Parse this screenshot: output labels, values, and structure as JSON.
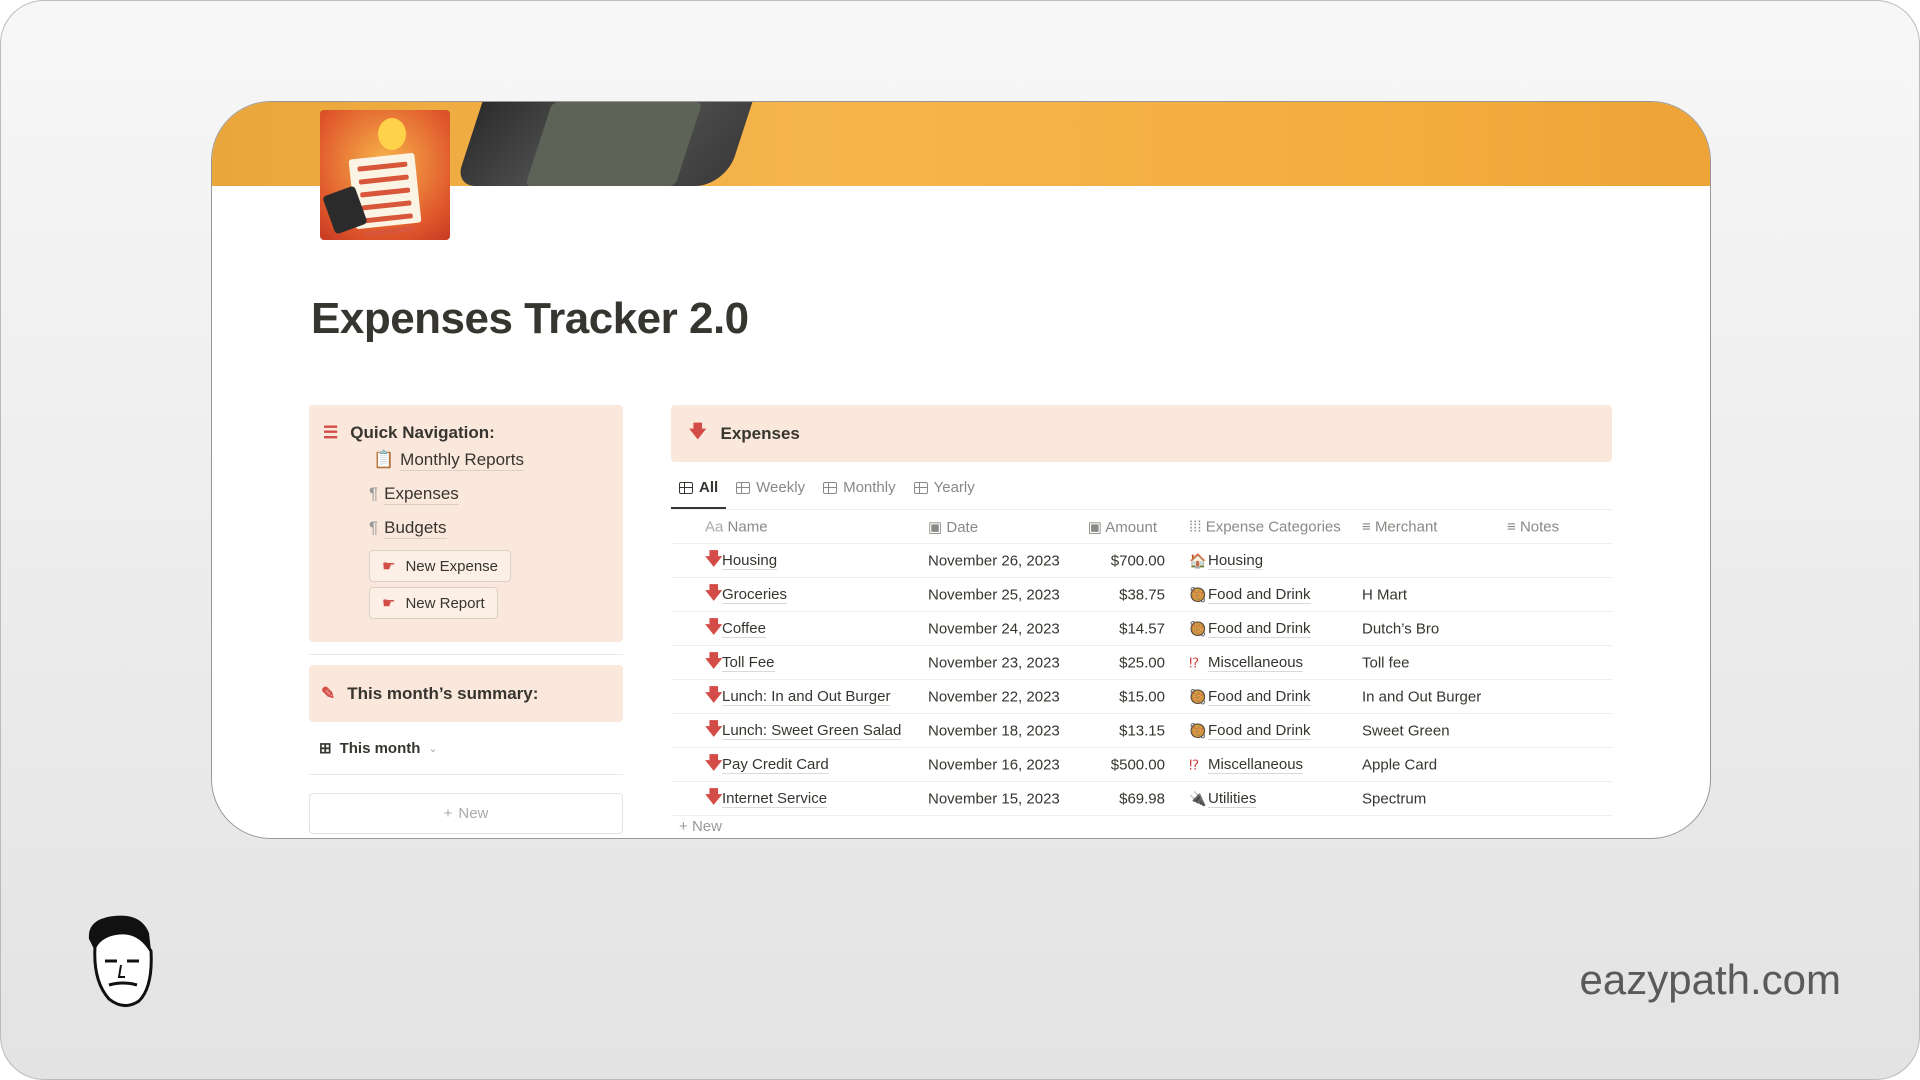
{
  "page": {
    "title": "Expenses Tracker 2.0"
  },
  "quick_nav": {
    "heading": "Quick Navigation:",
    "items": [
      {
        "label": "Monthly Reports",
        "icon": "report-icon"
      },
      {
        "label": "Expenses",
        "icon": "pilcrow-icon"
      },
      {
        "label": "Budgets",
        "icon": "pilcrow-icon"
      }
    ],
    "buttons": [
      {
        "label": "New Expense"
      },
      {
        "label": "New Report"
      }
    ]
  },
  "summary": {
    "heading": "This month’s summary:",
    "view_label": "This month",
    "new_label": "New"
  },
  "expenses": {
    "heading": "Expenses",
    "tabs": [
      {
        "label": "All",
        "active": true
      },
      {
        "label": "Weekly"
      },
      {
        "label": "Monthly"
      },
      {
        "label": "Yearly"
      }
    ],
    "columns": {
      "name": "Name",
      "name_prefix": "Aa",
      "date": "Date",
      "amount": "Amount",
      "category": "Expense Categories",
      "merchant": "Merchant",
      "notes": "Notes"
    },
    "rows": [
      {
        "name": "Housing",
        "date": "November 26, 2023",
        "amount": "$700.00",
        "category": "Housing",
        "cat_icon": "🏠",
        "merchant": ""
      },
      {
        "name": "Groceries",
        "date": "November 25, 2023",
        "amount": "$38.75",
        "category": "Food and Drink",
        "cat_icon": "🥘",
        "merchant": "H Mart"
      },
      {
        "name": "Coffee",
        "date": "November 24, 2023",
        "amount": "$14.57",
        "category": "Food and Drink",
        "cat_icon": "🥘",
        "merchant": "Dutch’s Bro"
      },
      {
        "name": "Toll Fee",
        "date": "November 23, 2023",
        "amount": "$25.00",
        "category": "Miscellaneous",
        "cat_icon": "⁉",
        "merchant": "Toll fee"
      },
      {
        "name": "Lunch: In and Out Burger",
        "date": "November 22, 2023",
        "amount": "$15.00",
        "category": "Food and Drink",
        "cat_icon": "🥘",
        "merchant": "In and Out Burger"
      },
      {
        "name": "Lunch: Sweet Green Salad",
        "date": "November 18, 2023",
        "amount": "$13.15",
        "category": "Food and Drink",
        "cat_icon": "🥘",
        "merchant": "Sweet Green"
      },
      {
        "name": "Pay Credit Card",
        "date": "November 16, 2023",
        "amount": "$500.00",
        "category": "Miscellaneous",
        "cat_icon": "⁉",
        "merchant": "Apple Card"
      },
      {
        "name": "Internet Service",
        "date": "November 15, 2023",
        "amount": "$69.98",
        "category": "Utilities",
        "cat_icon": "🔌",
        "merchant": "Spectrum"
      }
    ],
    "new_label": "New"
  },
  "brand": {
    "text": "eazypath.com"
  },
  "colors": {
    "accent": "#d44c47",
    "callout_bg": "#fbe8dc",
    "banner": "#f3ad3d"
  }
}
